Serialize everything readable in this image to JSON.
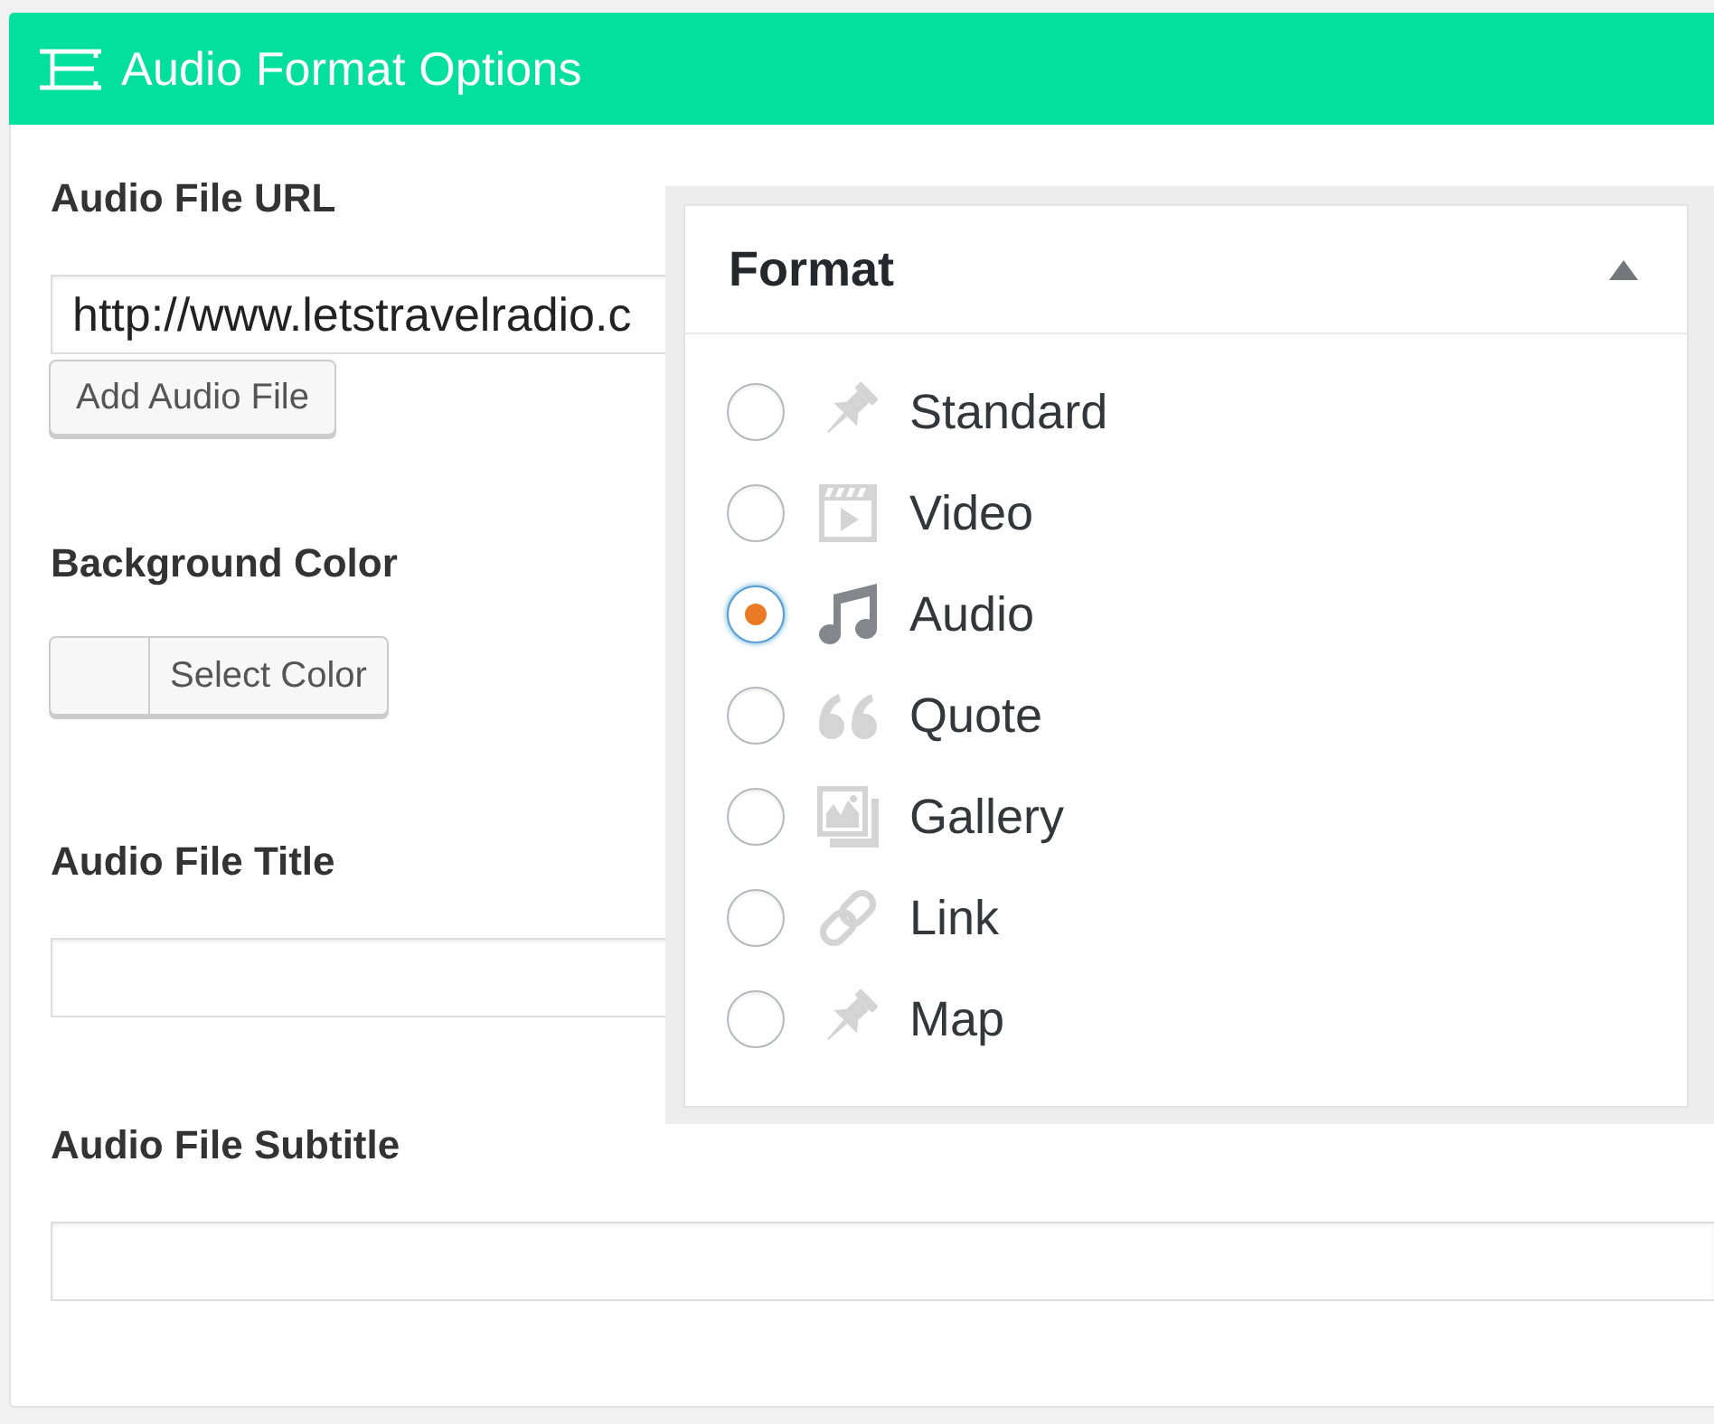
{
  "panel": {
    "title": "Audio Format Options"
  },
  "fields": [
    {
      "kind": "url",
      "label": "Audio File URL",
      "value": "http://www.letstravelradio.c",
      "button": "Add Audio File"
    },
    {
      "kind": "color",
      "label": "Background Color",
      "button": "Select Color"
    },
    {
      "kind": "text",
      "label": "Audio File Title"
    },
    {
      "kind": "text",
      "label": "Audio File Subtitle"
    }
  ],
  "format_box": {
    "title": "Format",
    "expanded": true,
    "options": [
      {
        "kind": "standard",
        "label": "Standard",
        "selected": false
      },
      {
        "kind": "video",
        "label": "Video",
        "selected": false
      },
      {
        "kind": "audio",
        "label": "Audio",
        "selected": true
      },
      {
        "kind": "quote",
        "label": "Quote",
        "selected": false
      },
      {
        "kind": "gallery",
        "label": "Gallery",
        "selected": false
      },
      {
        "kind": "link",
        "label": "Link",
        "selected": false
      },
      {
        "kind": "map",
        "label": "Map",
        "selected": false
      }
    ]
  }
}
